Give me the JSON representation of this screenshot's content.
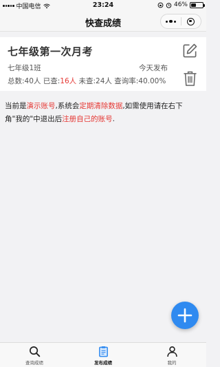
{
  "status_bar": {
    "carrier": "中国电信",
    "time": "23:24",
    "battery_percent": "46%",
    "battery_level": 0.46
  },
  "nav": {
    "title": "快查成绩",
    "capsule_more_icon": "more-dots-icon",
    "capsule_close_icon": "target-close-icon"
  },
  "card": {
    "title": "七年级第一次月考",
    "class_name": "七年级1班",
    "publish_time": "今天发布",
    "stats": {
      "total": "总数:40人",
      "checked_label": "已查:",
      "checked_value": "16人",
      "unchecked": "未查:24人",
      "rate": "查询率:40.00%"
    },
    "edit_icon": "edit-icon",
    "delete_icon": "trash-icon"
  },
  "notice": {
    "p1": "当前是",
    "h1": "演示账号",
    "p2": ",系统会",
    "h2": "定期清除数据",
    "p3": ",如需使用请在右下角\"我的\"中退出后",
    "h3": "注册自己的账号",
    "p4": "."
  },
  "fab": {
    "icon": "plus-icon"
  },
  "tabbar": {
    "tabs": [
      {
        "label": "查询成绩",
        "icon": "search-icon",
        "active": false
      },
      {
        "label": "发布成绩",
        "icon": "clipboard-icon",
        "active": true
      },
      {
        "label": "我的",
        "icon": "user-icon",
        "active": false
      }
    ]
  },
  "colors": {
    "accent_blue": "#2f8af0",
    "highlight_red": "#e53935",
    "background": "#f2f2f4"
  }
}
